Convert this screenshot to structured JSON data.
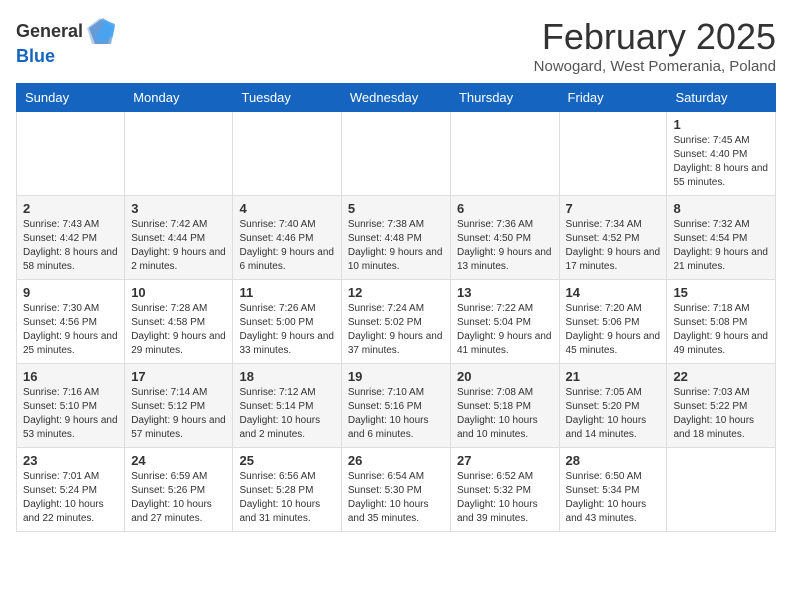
{
  "header": {
    "logo_general": "General",
    "logo_blue": "Blue",
    "title": "February 2025",
    "subtitle": "Nowogard, West Pomerania, Poland"
  },
  "days_of_week": [
    "Sunday",
    "Monday",
    "Tuesday",
    "Wednesday",
    "Thursday",
    "Friday",
    "Saturday"
  ],
  "weeks": [
    [
      {
        "day": "",
        "info": ""
      },
      {
        "day": "",
        "info": ""
      },
      {
        "day": "",
        "info": ""
      },
      {
        "day": "",
        "info": ""
      },
      {
        "day": "",
        "info": ""
      },
      {
        "day": "",
        "info": ""
      },
      {
        "day": "1",
        "info": "Sunrise: 7:45 AM\nSunset: 4:40 PM\nDaylight: 8 hours and 55 minutes."
      }
    ],
    [
      {
        "day": "2",
        "info": "Sunrise: 7:43 AM\nSunset: 4:42 PM\nDaylight: 8 hours and 58 minutes."
      },
      {
        "day": "3",
        "info": "Sunrise: 7:42 AM\nSunset: 4:44 PM\nDaylight: 9 hours and 2 minutes."
      },
      {
        "day": "4",
        "info": "Sunrise: 7:40 AM\nSunset: 4:46 PM\nDaylight: 9 hours and 6 minutes."
      },
      {
        "day": "5",
        "info": "Sunrise: 7:38 AM\nSunset: 4:48 PM\nDaylight: 9 hours and 10 minutes."
      },
      {
        "day": "6",
        "info": "Sunrise: 7:36 AM\nSunset: 4:50 PM\nDaylight: 9 hours and 13 minutes."
      },
      {
        "day": "7",
        "info": "Sunrise: 7:34 AM\nSunset: 4:52 PM\nDaylight: 9 hours and 17 minutes."
      },
      {
        "day": "8",
        "info": "Sunrise: 7:32 AM\nSunset: 4:54 PM\nDaylight: 9 hours and 21 minutes."
      }
    ],
    [
      {
        "day": "9",
        "info": "Sunrise: 7:30 AM\nSunset: 4:56 PM\nDaylight: 9 hours and 25 minutes."
      },
      {
        "day": "10",
        "info": "Sunrise: 7:28 AM\nSunset: 4:58 PM\nDaylight: 9 hours and 29 minutes."
      },
      {
        "day": "11",
        "info": "Sunrise: 7:26 AM\nSunset: 5:00 PM\nDaylight: 9 hours and 33 minutes."
      },
      {
        "day": "12",
        "info": "Sunrise: 7:24 AM\nSunset: 5:02 PM\nDaylight: 9 hours and 37 minutes."
      },
      {
        "day": "13",
        "info": "Sunrise: 7:22 AM\nSunset: 5:04 PM\nDaylight: 9 hours and 41 minutes."
      },
      {
        "day": "14",
        "info": "Sunrise: 7:20 AM\nSunset: 5:06 PM\nDaylight: 9 hours and 45 minutes."
      },
      {
        "day": "15",
        "info": "Sunrise: 7:18 AM\nSunset: 5:08 PM\nDaylight: 9 hours and 49 minutes."
      }
    ],
    [
      {
        "day": "16",
        "info": "Sunrise: 7:16 AM\nSunset: 5:10 PM\nDaylight: 9 hours and 53 minutes."
      },
      {
        "day": "17",
        "info": "Sunrise: 7:14 AM\nSunset: 5:12 PM\nDaylight: 9 hours and 57 minutes."
      },
      {
        "day": "18",
        "info": "Sunrise: 7:12 AM\nSunset: 5:14 PM\nDaylight: 10 hours and 2 minutes."
      },
      {
        "day": "19",
        "info": "Sunrise: 7:10 AM\nSunset: 5:16 PM\nDaylight: 10 hours and 6 minutes."
      },
      {
        "day": "20",
        "info": "Sunrise: 7:08 AM\nSunset: 5:18 PM\nDaylight: 10 hours and 10 minutes."
      },
      {
        "day": "21",
        "info": "Sunrise: 7:05 AM\nSunset: 5:20 PM\nDaylight: 10 hours and 14 minutes."
      },
      {
        "day": "22",
        "info": "Sunrise: 7:03 AM\nSunset: 5:22 PM\nDaylight: 10 hours and 18 minutes."
      }
    ],
    [
      {
        "day": "23",
        "info": "Sunrise: 7:01 AM\nSunset: 5:24 PM\nDaylight: 10 hours and 22 minutes."
      },
      {
        "day": "24",
        "info": "Sunrise: 6:59 AM\nSunset: 5:26 PM\nDaylight: 10 hours and 27 minutes."
      },
      {
        "day": "25",
        "info": "Sunrise: 6:56 AM\nSunset: 5:28 PM\nDaylight: 10 hours and 31 minutes."
      },
      {
        "day": "26",
        "info": "Sunrise: 6:54 AM\nSunset: 5:30 PM\nDaylight: 10 hours and 35 minutes."
      },
      {
        "day": "27",
        "info": "Sunrise: 6:52 AM\nSunset: 5:32 PM\nDaylight: 10 hours and 39 minutes."
      },
      {
        "day": "28",
        "info": "Sunrise: 6:50 AM\nSunset: 5:34 PM\nDaylight: 10 hours and 43 minutes."
      },
      {
        "day": "",
        "info": ""
      }
    ]
  ]
}
